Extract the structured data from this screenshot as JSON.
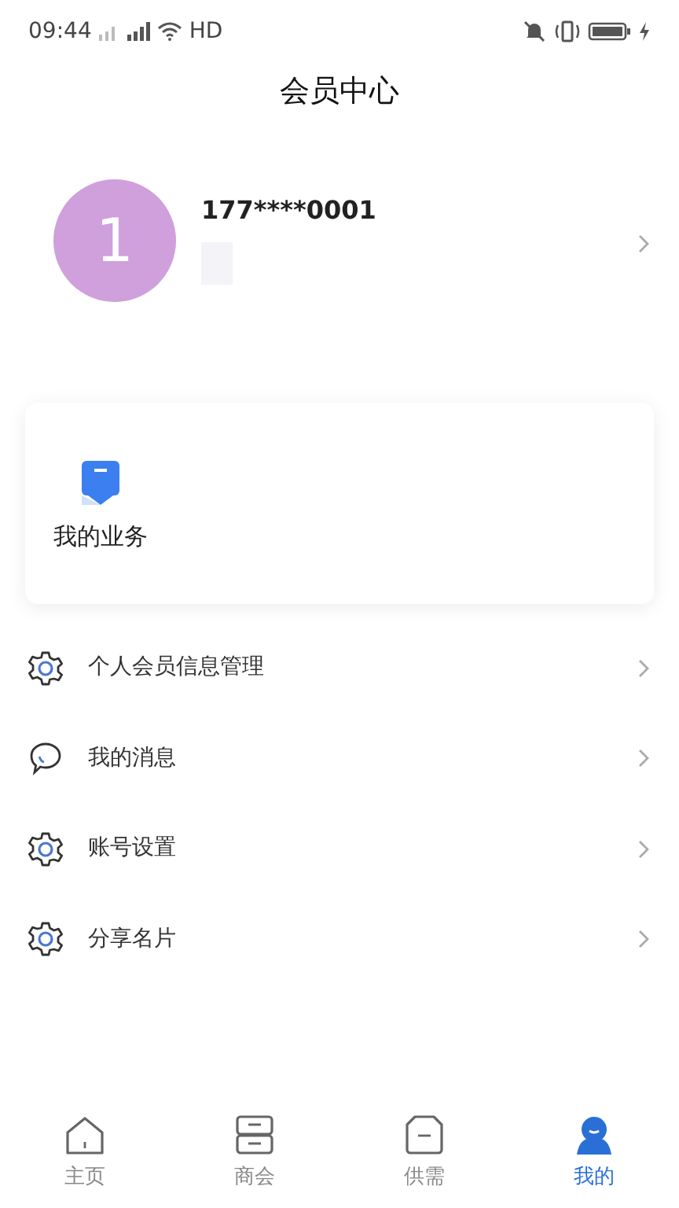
{
  "status_bar": {
    "time": "09:44",
    "network": "HD"
  },
  "header": {
    "title": "会员中心"
  },
  "profile": {
    "avatar": "1",
    "phone": "177****0001"
  },
  "business_card": {
    "items": [
      {
        "label": "我的业务"
      }
    ]
  },
  "menu": [
    {
      "label": "个人会员信息管理",
      "kind": "gear"
    },
    {
      "label": "我的消息",
      "kind": "chat"
    },
    {
      "label": "账号设置",
      "kind": "gear"
    },
    {
      "label": "分享名片",
      "kind": "gear"
    }
  ],
  "tabs": [
    {
      "label": "主页",
      "kind": "home",
      "selected": false
    },
    {
      "label": "商会",
      "kind": "drawer",
      "selected": false
    },
    {
      "label": "供需",
      "kind": "box",
      "selected": false
    },
    {
      "label": "我的",
      "kind": "person",
      "selected": true
    }
  ]
}
